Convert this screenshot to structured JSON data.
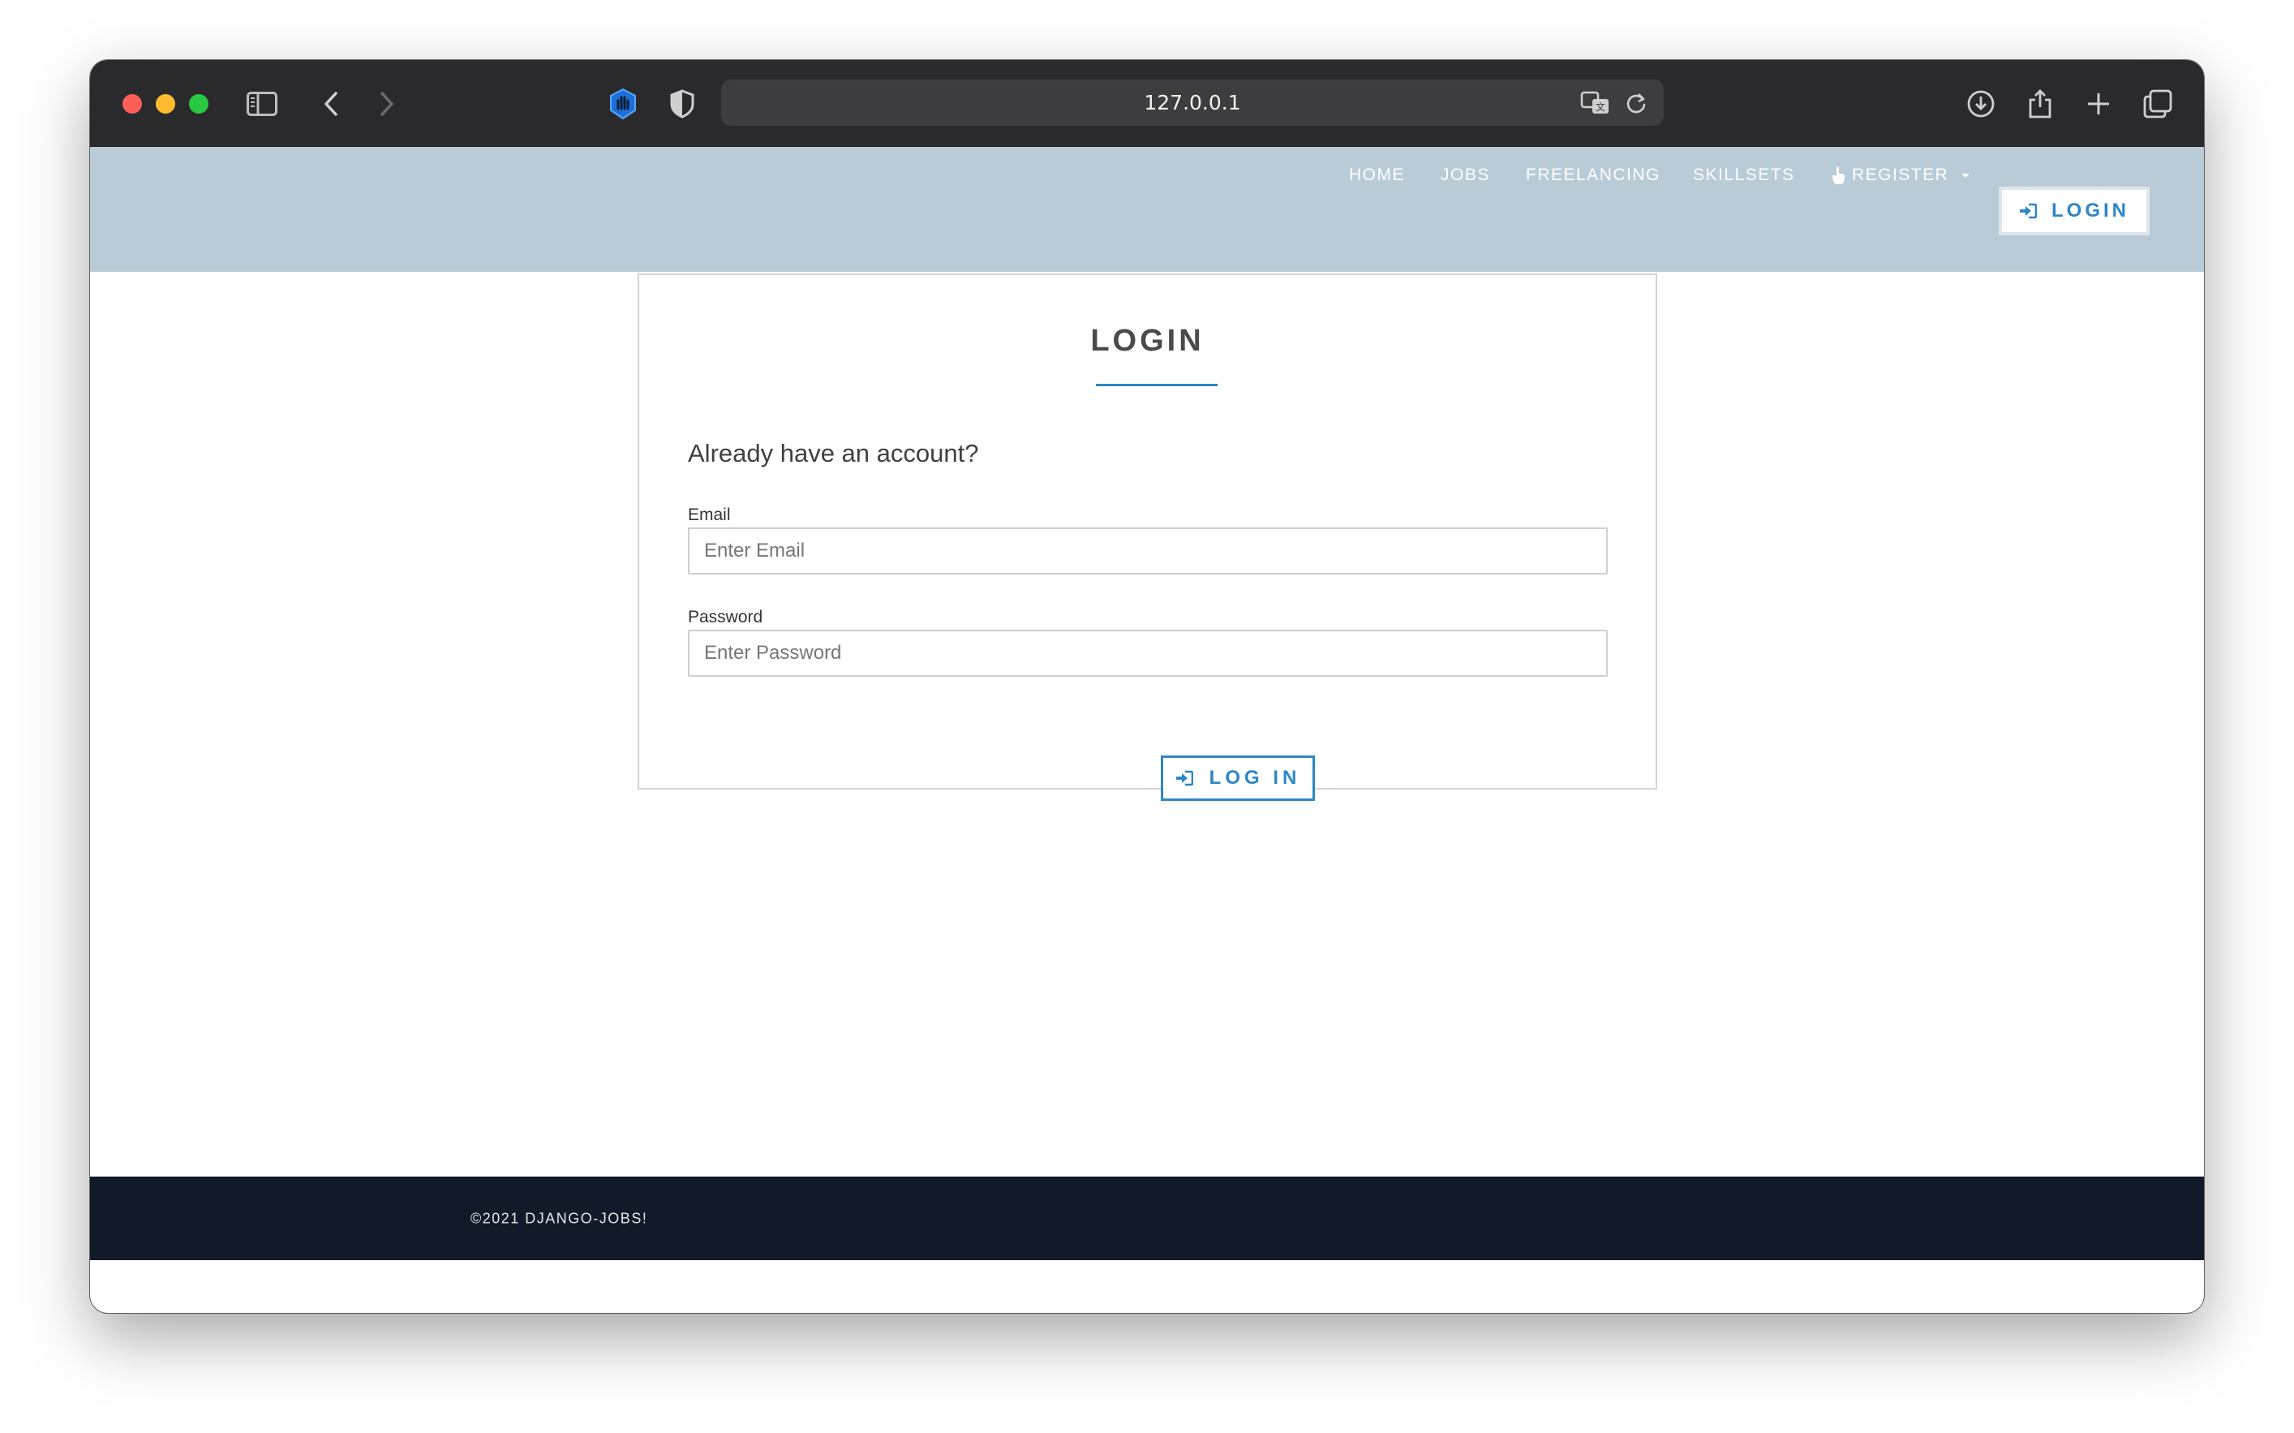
{
  "browser": {
    "url": "127.0.0.1"
  },
  "navbar": {
    "items": [
      {
        "label": "HOME"
      },
      {
        "label": "JOBS"
      },
      {
        "label": "FREELANCING"
      },
      {
        "label": "SKILLSETS"
      }
    ],
    "register_label": "REGISTER",
    "login_label": "LOGIN"
  },
  "login_form": {
    "title": "LOGIN",
    "subtitle": "Already have an account?",
    "email_label": "Email",
    "email_placeholder": "Enter Email",
    "email_value": "",
    "password_label": "Password",
    "password_placeholder": "Enter Password",
    "password_value": "",
    "submit_label": "LOG IN"
  },
  "footer": {
    "copyright": "©2021 DJANGO-JOBS!"
  },
  "colors": {
    "navbar_bg": "#b8cbd7",
    "accent": "#2d86c7",
    "footer_bg": "#111a28"
  }
}
